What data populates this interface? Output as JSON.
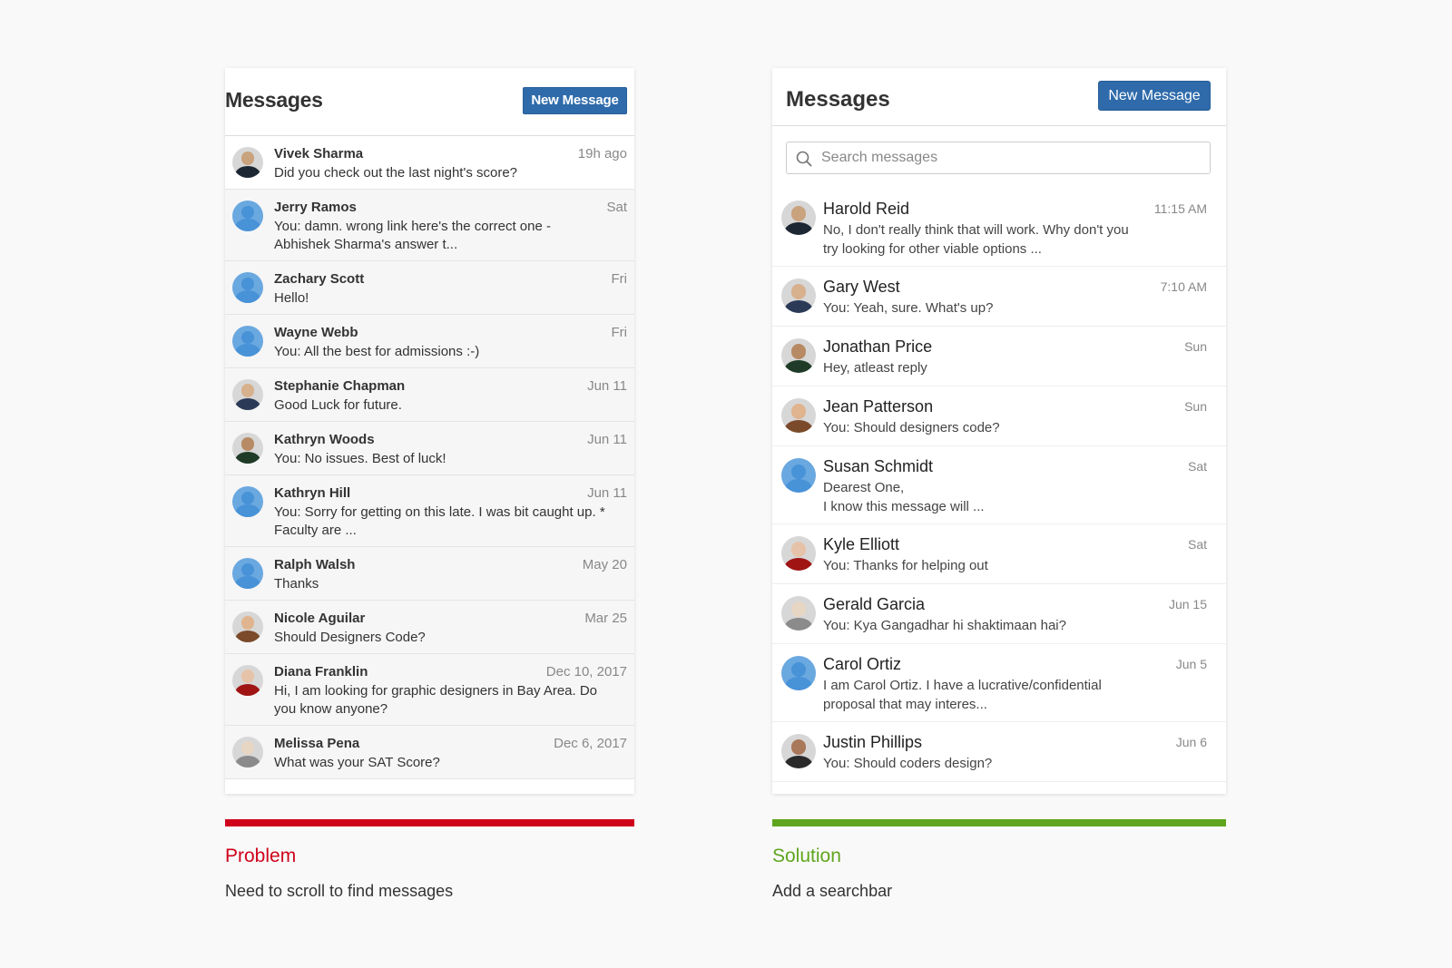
{
  "problem_panel": {
    "title": "Messages",
    "new_button": "New Message",
    "messages": [
      {
        "name": "Vivek Sharma",
        "time": "19h ago",
        "preview": "Did you check out the last night's score?",
        "avatar": "photo"
      },
      {
        "name": "Jerry Ramos",
        "time": "Sat",
        "preview": "You: damn. wrong link here's the correct one - Abhishek Sharma's answer t...",
        "avatar": "default"
      },
      {
        "name": "Zachary Scott",
        "time": "Fri",
        "preview": "Hello!",
        "avatar": "default"
      },
      {
        "name": "Wayne Webb",
        "time": "Fri",
        "preview": "You: All the best for admissions :-)",
        "avatar": "default"
      },
      {
        "name": "Stephanie Chapman",
        "time": "Jun 11",
        "preview": "Good Luck for future.",
        "avatar": "photo"
      },
      {
        "name": "Kathryn Woods",
        "time": "Jun 11",
        "preview": "You: No issues. Best of luck!",
        "avatar": "photo"
      },
      {
        "name": "Kathryn Hill",
        "time": "Jun 11",
        "preview": "You: Sorry for getting on this late. I was bit caught up. * Faculty are ...",
        "avatar": "default"
      },
      {
        "name": "Ralph Walsh",
        "time": "May 20",
        "preview": "Thanks",
        "avatar": "default"
      },
      {
        "name": "Nicole Aguilar",
        "time": "Mar 25",
        "preview": "Should Designers Code?",
        "avatar": "photo"
      },
      {
        "name": "Diana Franklin",
        "time": "Dec 10, 2017",
        "preview": "Hi, I am looking for graphic designers in Bay Area. Do you know anyone?",
        "avatar": "photo"
      },
      {
        "name": "Melissa Pena",
        "time": "Dec 6, 2017",
        "preview": "What was your SAT Score?",
        "avatar": "photo"
      }
    ]
  },
  "solution_panel": {
    "title": "Messages",
    "new_button": "New Message",
    "search": {
      "placeholder": "Search messages",
      "icon": "search-icon"
    },
    "messages": [
      {
        "name": "Harold Reid",
        "time": "11:15 AM",
        "preview": "No, I don't really think that will work. Why don't you try looking for other viable options ...",
        "avatar": "photo"
      },
      {
        "name": "Gary West",
        "time": "7:10 AM",
        "preview": "You: Yeah, sure. What's up?",
        "avatar": "photo"
      },
      {
        "name": "Jonathan Price",
        "time": "Sun",
        "preview": "Hey, atleast reply",
        "avatar": "photo"
      },
      {
        "name": "Jean Patterson",
        "time": "Sun",
        "preview": "You: Should designers code?",
        "avatar": "photo"
      },
      {
        "name": "Susan Schmidt",
        "time": "Sat",
        "preview": "Dearest One,\nI know this message will ...",
        "avatar": "default"
      },
      {
        "name": "Kyle Elliott",
        "time": "Sat",
        "preview": "You: Thanks for helping out",
        "avatar": "photo"
      },
      {
        "name": "Gerald Garcia",
        "time": "Jun 15",
        "preview": "You: Kya Gangadhar hi shaktimaan hai?",
        "avatar": "photo"
      },
      {
        "name": "Carol Ortiz",
        "time": "Jun 5",
        "preview": "I am Carol Ortiz. I have a lucrative/confidential proposal that may interes...",
        "avatar": "default"
      },
      {
        "name": "Justin Phillips",
        "time": "Jun 6",
        "preview": "You: Should coders design?",
        "avatar": "photo"
      }
    ]
  },
  "captions": {
    "problem_title": "Problem",
    "problem_text": "Need to scroll to find messages",
    "solution_title": "Solution",
    "solution_text": "Add a searchbar"
  },
  "colors": {
    "accent_button": "#2f6bab",
    "problem": "#d0021b",
    "solution": "#5fa51d",
    "default_avatar": "#6aa8e0"
  }
}
